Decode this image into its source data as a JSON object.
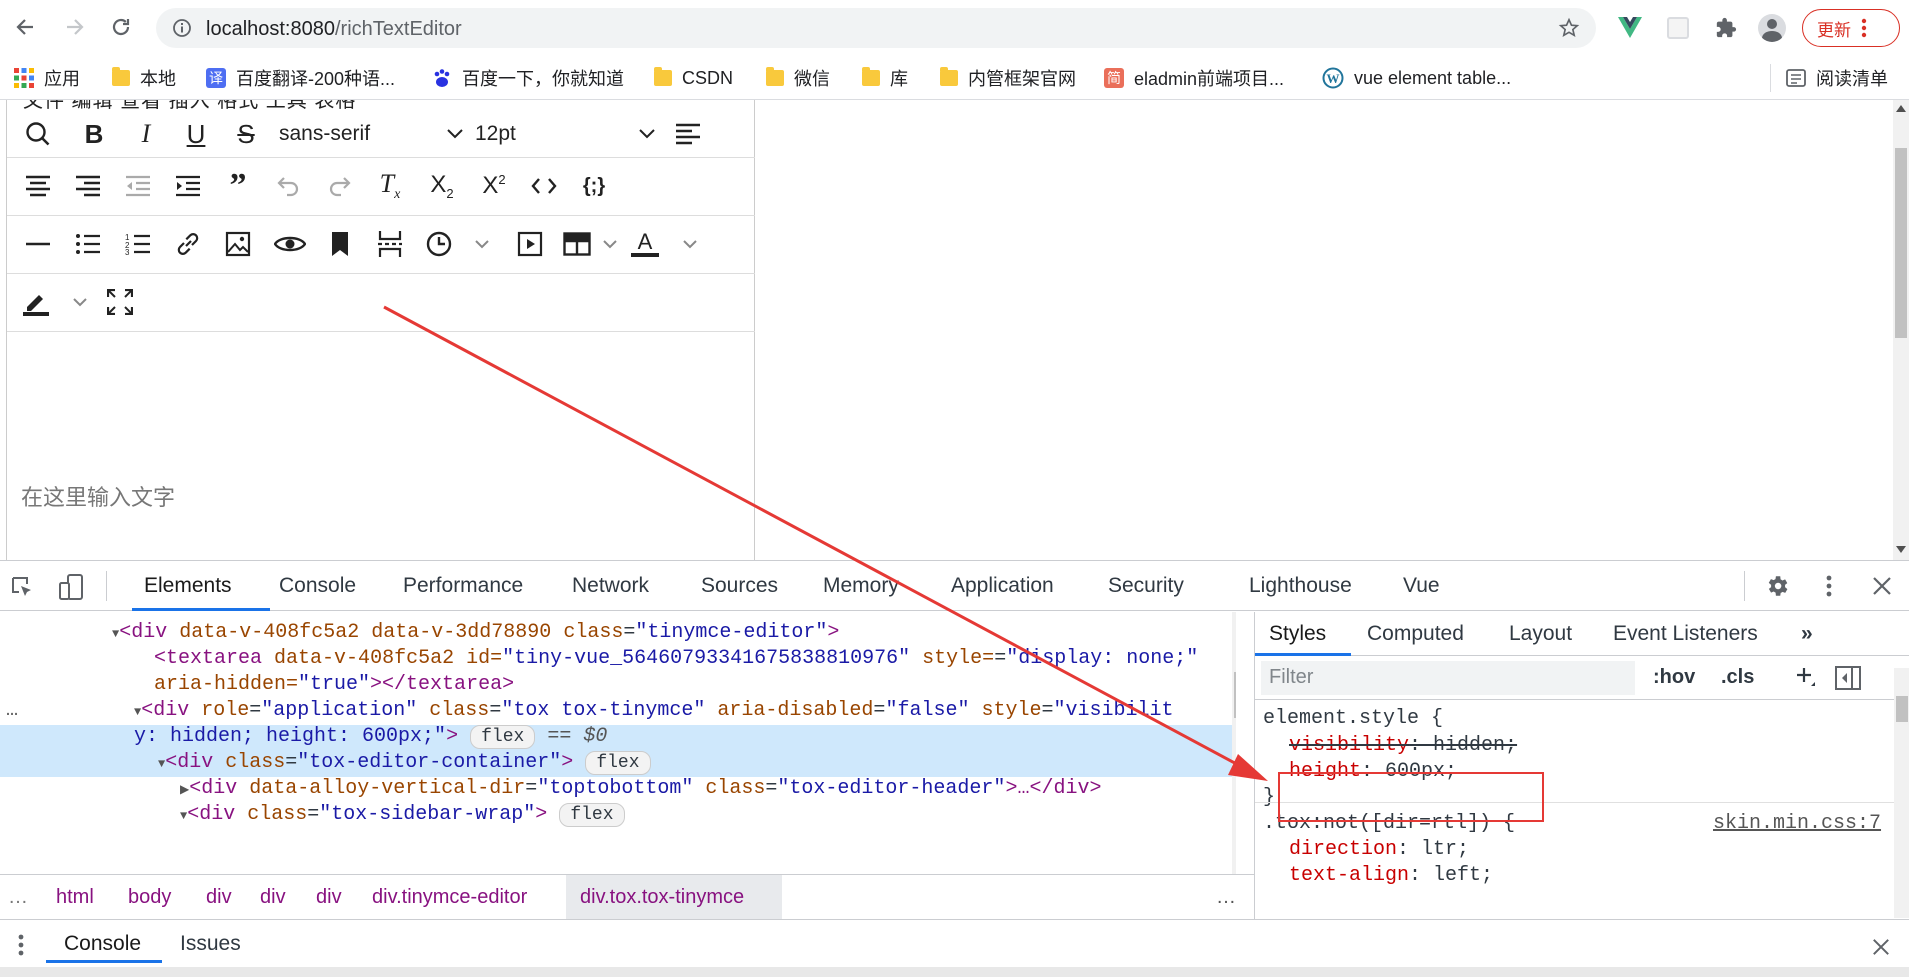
{
  "browser": {
    "url_host": "localhost:8080",
    "url_path": "/richTextEditor",
    "update_label": "更新",
    "bookmarks": [
      {
        "label": "应用",
        "icon": "apps-grid-icon"
      },
      {
        "label": "本地",
        "icon": "folder-icon"
      },
      {
        "label": "百度翻译-200种语...",
        "icon": "translate-icon"
      },
      {
        "label": "百度一下，你就知道",
        "icon": "baidu-paw-icon"
      },
      {
        "label": "CSDN",
        "icon": "folder-icon"
      },
      {
        "label": "微信",
        "icon": "folder-icon"
      },
      {
        "label": "库",
        "icon": "folder-icon"
      },
      {
        "label": "内管框架官网",
        "icon": "folder-icon"
      },
      {
        "label": "eladmin前端项目...",
        "icon": "jianshu-icon"
      },
      {
        "label": "vue element table...",
        "icon": "wordpress-icon"
      }
    ],
    "reading_list": "阅读清单"
  },
  "editor": {
    "menubar": "文件  编辑  查看  插入  格式  工具  表格",
    "font_family": "sans-serif",
    "font_size": "12pt",
    "placeholder": "在这里输入文字"
  },
  "devtools": {
    "tabs": [
      "Elements",
      "Console",
      "Performance",
      "Network",
      "Sources",
      "Memory",
      "Application",
      "Security",
      "Lighthouse",
      "Vue"
    ],
    "elements": {
      "line1_tag": "div",
      "line1_attrs": "data-v-408fc5a2 data-v-3dd78890 ",
      "line1_class_attr": "class",
      "line1_class_val": "\"tinymce-editor\"",
      "line2": "<textarea data-v-408fc5a2 id=\"tiny-vue_5646079334167583881 0976\" style=\"display: none;\"",
      "line2_a": "textarea",
      "line2_b": "data-v-408fc5a2 id=",
      "line2_c": "\"tiny-vue_56460793341675838810976\"",
      "line2_d": " style=",
      "line2_e": "\"display: none;\"",
      "line3_a": "aria-hidden=",
      "line3_b": "\"true\"",
      "line3_c": "></textarea>",
      "sel_role": "\"application\"",
      "sel_class": "\"tox tox-tinymce\"",
      "sel_aria": "\"false\"",
      "sel_style_1": "\"visibilit",
      "sel_style_2": "y: hidden; height: 600px;\"",
      "flex": "flex",
      "dollar": "== $0",
      "line6_class": "\"tox-editor-container\"",
      "line7_dir": "\"toptobottom\"",
      "line7_class": "\"tox-editor-header\"",
      "line8_class": "\"tox-sidebar-wrap\""
    },
    "breadcrumbs": [
      "html",
      "body",
      "div",
      "div",
      "div",
      "div.tinymce-editor",
      "div.tox.tox-tinymce"
    ],
    "styles_tabs": [
      "Styles",
      "Computed",
      "Layout",
      "Event Listeners"
    ],
    "filter_placeholder": "Filter",
    "hov": ":hov",
    "cls": ".cls",
    "rule1_selector": "element.style {",
    "rule1_prop1": "visibility",
    "rule1_val1": " hidden;",
    "rule1_prop2": "height",
    "rule1_val2": " 600px;",
    "rule2_selector": ".tox:not([dir=rtl]) {",
    "rule2_source": "skin.min.css:7",
    "rule2_prop1": "direction",
    "rule2_val1": " ltr;",
    "rule2_prop2": "text-align",
    "rule2_val2": " left;",
    "drawer_tabs": [
      "Console",
      "Issues"
    ]
  },
  "annotation": {
    "arrow_color": "#e53935",
    "box_color": "#e53935"
  }
}
